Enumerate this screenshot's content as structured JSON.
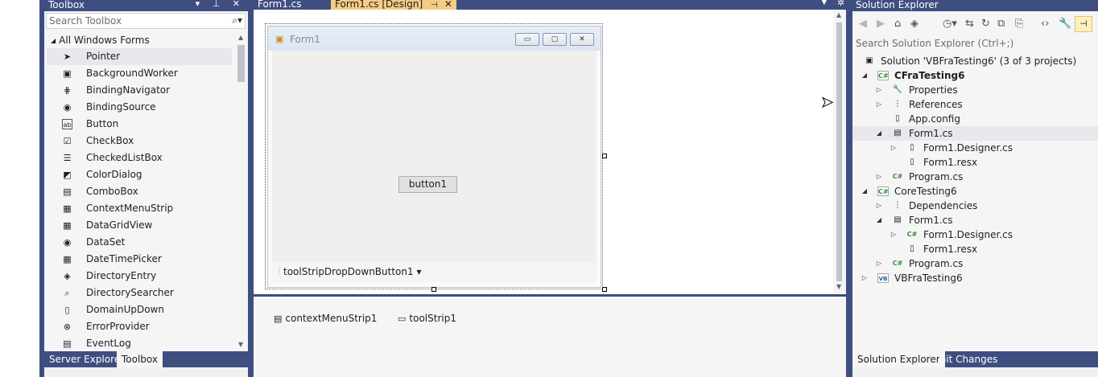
{
  "toolbox": {
    "title": "Toolbox",
    "header_buttons": "▾ ⊥ ✕",
    "search_placeholder": "Search Toolbox",
    "category": "All Windows Forms",
    "items": [
      {
        "label": "Pointer",
        "icon": "pointer-icon",
        "glyph": "➤"
      },
      {
        "label": "BackgroundWorker",
        "icon": "background-worker-icon",
        "glyph": "▣"
      },
      {
        "label": "BindingNavigator",
        "icon": "binding-navigator-icon",
        "glyph": "⋕"
      },
      {
        "label": "BindingSource",
        "icon": "binding-source-icon",
        "glyph": "◉"
      },
      {
        "label": "Button",
        "icon": "button-icon",
        "glyph": "ab"
      },
      {
        "label": "CheckBox",
        "icon": "checkbox-icon",
        "glyph": "☑"
      },
      {
        "label": "CheckedListBox",
        "icon": "checked-list-box-icon",
        "glyph": "☰"
      },
      {
        "label": "ColorDialog",
        "icon": "color-dialog-icon",
        "glyph": "◩"
      },
      {
        "label": "ComboBox",
        "icon": "combobox-icon",
        "glyph": "▤"
      },
      {
        "label": "ContextMenuStrip",
        "icon": "context-menu-strip-icon",
        "glyph": "▦"
      },
      {
        "label": "DataGridView",
        "icon": "data-grid-view-icon",
        "glyph": "▦"
      },
      {
        "label": "DataSet",
        "icon": "dataset-icon",
        "glyph": "◉"
      },
      {
        "label": "DateTimePicker",
        "icon": "date-time-picker-icon",
        "glyph": "▦"
      },
      {
        "label": "DirectoryEntry",
        "icon": "directory-entry-icon",
        "glyph": "◈"
      },
      {
        "label": "DirectorySearcher",
        "icon": "directory-searcher-icon",
        "glyph": "⌕"
      },
      {
        "label": "DomainUpDown",
        "icon": "domain-up-down-icon",
        "glyph": "▯"
      },
      {
        "label": "ErrorProvider",
        "icon": "error-provider-icon",
        "glyph": "⊗"
      },
      {
        "label": "EventLog",
        "icon": "event-log-icon",
        "glyph": "▤"
      }
    ],
    "tabs": [
      "Server Explorer",
      "Toolbox"
    ]
  },
  "editor": {
    "tabs": [
      {
        "label": "Form1.cs"
      },
      {
        "label": "Form1.cs [Design]",
        "pin": "⊣",
        "close": "✕"
      }
    ],
    "form": {
      "title": "Form1",
      "minimize": "▭",
      "maximize": "▢",
      "close": "✕",
      "button_label": "button1",
      "toolstrip_button": "toolStripDropDownButton1 ▾"
    },
    "tray": [
      {
        "label": "contextMenuStrip1",
        "glyph": "▤"
      },
      {
        "label": "toolStrip1",
        "glyph": "▭"
      }
    ]
  },
  "solution_explorer": {
    "title": "Solution Explorer",
    "search_placeholder": "Search Solution Explorer (Ctrl+;)",
    "pin_glyph": "⊣",
    "tree": [
      {
        "label": "Solution 'VBFraTesting6' (3 of 3 projects)",
        "level": 0,
        "exp": "",
        "ico": "▣",
        "icon": "solution-icon",
        "bold": false,
        "sel": false
      },
      {
        "label": "CFraTesting6",
        "level": 0,
        "exp": "◢",
        "ico": "C#",
        "icon": "csharp-project-icon",
        "type": "cs",
        "bold": true,
        "sel": false
      },
      {
        "label": "Properties",
        "level": 1,
        "exp": "▷",
        "ico": "🔧",
        "icon": "wrench-icon",
        "bold": false,
        "sel": false
      },
      {
        "label": "References",
        "level": 1,
        "exp": "▷",
        "ico": "⋮",
        "icon": "references-icon",
        "bold": false,
        "sel": false
      },
      {
        "label": "App.config",
        "level": 1,
        "exp": "",
        "ico": "▯",
        "icon": "config-file-icon",
        "bold": false,
        "sel": false
      },
      {
        "label": "Form1.cs",
        "level": 1,
        "exp": "◢",
        "ico": "▤",
        "icon": "form-icon",
        "bold": false,
        "sel": true
      },
      {
        "label": "Form1.Designer.cs",
        "level": 2,
        "exp": "▷",
        "ico": "▯",
        "icon": "designer-file-icon",
        "bold": false,
        "sel": false
      },
      {
        "label": "Form1.resx",
        "level": 2,
        "exp": "",
        "ico": "▯",
        "icon": "resx-file-icon",
        "bold": false,
        "sel": false
      },
      {
        "label": "Program.cs",
        "level": 1,
        "exp": "▷",
        "ico": "C#",
        "icon": "csharp-file-icon",
        "type": "csfile",
        "bold": false,
        "sel": false
      },
      {
        "label": "CoreTesting6",
        "level": 0,
        "exp": "◢",
        "ico": "C#",
        "icon": "csharp-project-icon",
        "type": "cs",
        "bold": false,
        "sel": false
      },
      {
        "label": "Dependencies",
        "level": 1,
        "exp": "▷",
        "ico": "⋮",
        "icon": "dependencies-icon",
        "bold": false,
        "sel": false
      },
      {
        "label": "Form1.cs",
        "level": 1,
        "exp": "◢",
        "ico": "▤",
        "icon": "form-icon",
        "bold": false,
        "sel": false
      },
      {
        "label": "Form1.Designer.cs",
        "level": 2,
        "exp": "▷",
        "ico": "C#",
        "icon": "csharp-file-icon",
        "type": "csfile",
        "bold": false,
        "sel": false
      },
      {
        "label": "Form1.resx",
        "level": 2,
        "exp": "",
        "ico": "▯",
        "icon": "resx-file-icon",
        "bold": false,
        "sel": false
      },
      {
        "label": "Program.cs",
        "level": 1,
        "exp": "▷",
        "ico": "C#",
        "icon": "csharp-file-icon",
        "type": "csfile",
        "bold": false,
        "sel": false
      },
      {
        "label": "VBFraTesting6",
        "level": 0,
        "exp": "▷",
        "ico": "VB",
        "icon": "vb-project-icon",
        "type": "vb",
        "bold": false,
        "sel": false
      }
    ],
    "tabs": [
      "Solution Explorer",
      "Git Changes"
    ]
  },
  "colors": {
    "chrome_blue": "#3f4e80",
    "active_tab": "#f5cc84",
    "panel_bg": "#f5f5f5"
  }
}
